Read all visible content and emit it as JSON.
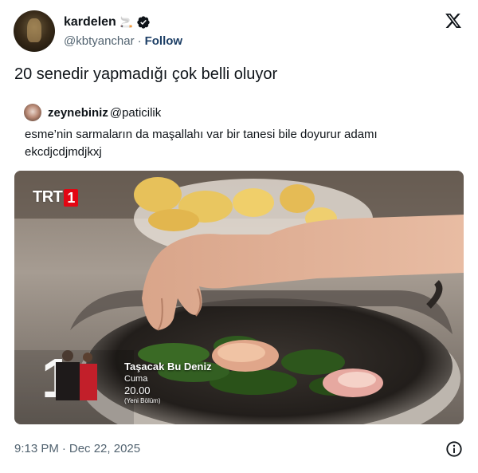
{
  "author": {
    "display_name": "kardelen",
    "name_emoji": "🚬",
    "handle": "@kbtyanchar",
    "separator": "·",
    "follow_label": "Follow"
  },
  "icons": {
    "verified": "verified-badge-icon",
    "brand": "x-logo-icon",
    "info": "info-icon"
  },
  "tweet": {
    "text": "20 senedir yapmadığı çok belli oluyor"
  },
  "quoted": {
    "display_name": "zeynebiniz",
    "handle": "@paticilik",
    "text": "esme’nin sarmaların da maşallahı var bir tanesi bile doyurur adamı ekcdjcdjmdjkxj"
  },
  "media": {
    "channel_logo_text": "TRT",
    "channel_logo_number": "1",
    "promo": {
      "number": "1",
      "title": "Taşacak Bu Deniz",
      "day": "Cuma",
      "time": "20.00",
      "episode": "(Yeni Bölüm)"
    }
  },
  "footer": {
    "time": "9:13 PM",
    "separator": "·",
    "date": "Dec 22, 2025"
  },
  "colors": {
    "text": "#0f1419",
    "secondary": "#536471",
    "follow": "#1d3f66",
    "verified_badge": "#0f1419",
    "trt_red": "#e30613"
  }
}
